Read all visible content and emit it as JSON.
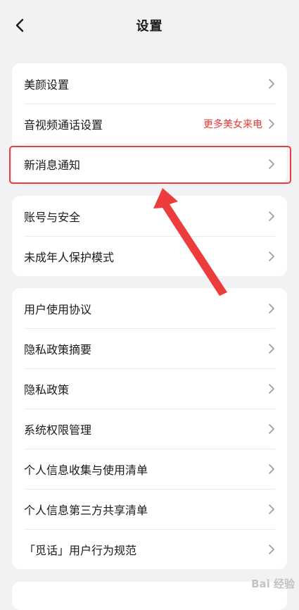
{
  "header": {
    "title": "设置"
  },
  "cards": [
    {
      "items": [
        {
          "label": "美颜设置"
        },
        {
          "label": "音视频通话设置",
          "extra": "更多美女来电"
        },
        {
          "label": "新消息通知"
        }
      ]
    },
    {
      "items": [
        {
          "label": "账号与安全"
        },
        {
          "label": "未成年人保护模式"
        }
      ]
    },
    {
      "items": [
        {
          "label": "用户使用协议"
        },
        {
          "label": "隐私政策摘要"
        },
        {
          "label": "隐私政策"
        },
        {
          "label": "系统权限管理"
        },
        {
          "label": "个人信息收集与使用清单"
        },
        {
          "label": "个人信息第三方共享清单"
        },
        {
          "label": "「觅话」用户行为规范"
        }
      ]
    }
  ],
  "annotation": {
    "color": "#ec3c3c"
  },
  "watermark": "Bai 经验"
}
